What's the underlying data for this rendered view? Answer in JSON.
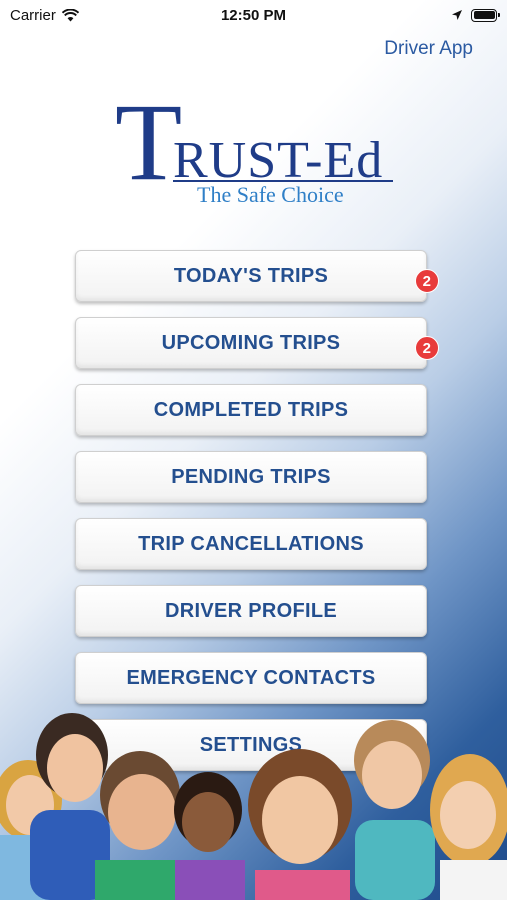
{
  "status": {
    "carrier": "Carrier",
    "time": "12:50 PM"
  },
  "header": {
    "nav_link": "Driver App"
  },
  "logo": {
    "first_letter": "T",
    "rest": "RUST-Ed",
    "tagline": "The Safe Choice",
    "color": "#1f3c88",
    "tagline_color": "#2f7fc7"
  },
  "menu": {
    "items": [
      {
        "label": "TODAY'S TRIPS",
        "badge": "2"
      },
      {
        "label": "UPCOMING TRIPS",
        "badge": "2"
      },
      {
        "label": "COMPLETED TRIPS"
      },
      {
        "label": "PENDING TRIPS"
      },
      {
        "label": "TRIP CANCELLATIONS"
      },
      {
        "label": "DRIVER PROFILE"
      },
      {
        "label": "EMERGENCY CONTACTS"
      },
      {
        "label": "SETTINGS"
      }
    ],
    "text_color": "#244f8f",
    "badge_color": "#e83b3b"
  },
  "icons": [
    "wifi-icon",
    "location-arrow-icon",
    "battery-icon"
  ]
}
